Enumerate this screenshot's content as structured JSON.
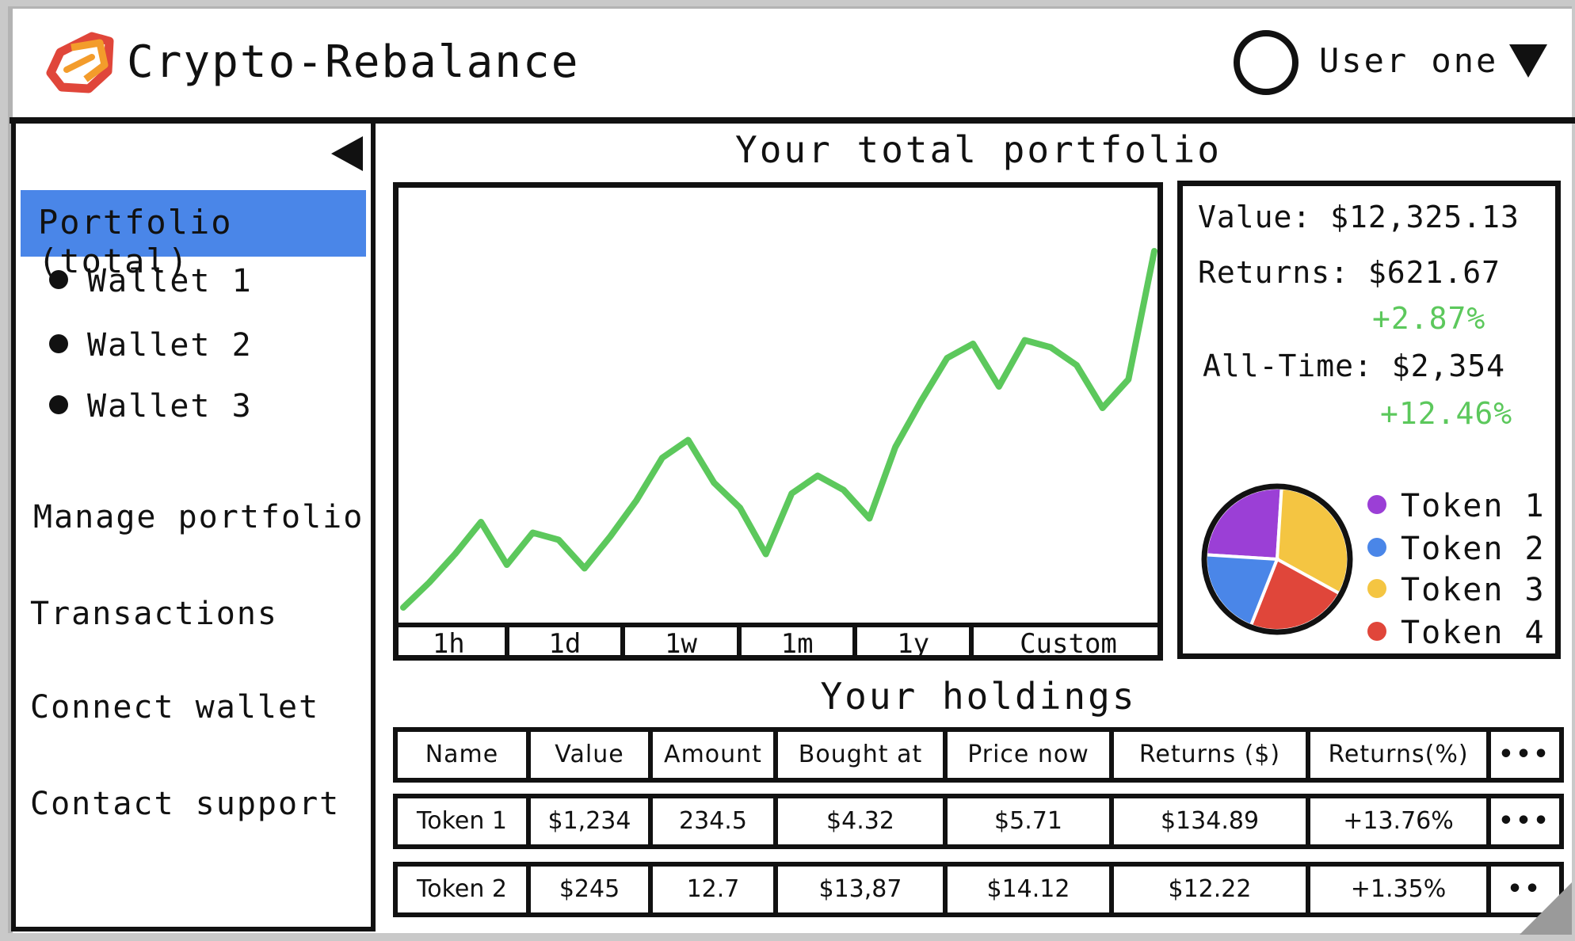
{
  "header": {
    "app_title": "Crypto-Rebalance",
    "user_name": "User one"
  },
  "sidebar": {
    "active_item": "Portfolio (total)",
    "wallets": [
      "Wallet 1",
      "Wallet 2",
      "Wallet 3"
    ],
    "nav_items": [
      "Manage portfolio",
      "Transactions",
      "Connect wallet",
      "Contact support"
    ]
  },
  "portfolio": {
    "title": "Your total portfolio",
    "time_ranges": [
      "1h",
      "1d",
      "1w",
      "1m",
      "1y",
      "Custom"
    ],
    "value": "Value: $12,325.13",
    "returns": "Returns: $621.67",
    "returns_pct": "+2.87%",
    "all_time": "All-Time: $2,354",
    "all_time_pct": "+12.46%",
    "tokens": [
      {
        "name": "Token 1",
        "color": "#9b3fd6",
        "share": 0.25
      },
      {
        "name": "Token 2",
        "color": "#4a86e8",
        "share": 0.2
      },
      {
        "name": "Token 3",
        "color": "#f4c542",
        "share": 0.32
      },
      {
        "name": "Token 4",
        "color": "#e0463a",
        "share": 0.23
      }
    ]
  },
  "holdings": {
    "title": "Your holdings",
    "columns": [
      "Name",
      "Value",
      "Amount",
      "Bought at",
      "Price now",
      "Returns ($)",
      "Returns(%)",
      "•••"
    ],
    "rows": [
      [
        "Token 1",
        "$1,234",
        "234.5",
        "$4.32",
        "$5.71",
        "$134.89",
        "+13.76%",
        "•••"
      ],
      [
        "Token 2",
        "$245",
        "12.7",
        "$13,87",
        "$14.12",
        "$12.22",
        "+1.35%",
        "••"
      ]
    ]
  },
  "colors": {
    "accent": "#4a86e8",
    "chart_line": "#5cc85c",
    "positive": "#5cc85c"
  },
  "chart_data": [
    {
      "type": "line",
      "series": [
        {
          "values": [
            0,
            7,
            15,
            24,
            12,
            21,
            19,
            11,
            20,
            30,
            42,
            47,
            35,
            28,
            15,
            32,
            37,
            33,
            25,
            45,
            58,
            70,
            74,
            62,
            75,
            73,
            68,
            56,
            64,
            100
          ]
        }
      ],
      "grid": false
    },
    {
      "type": "pie",
      "categories": [
        "Token 1",
        "Token 2",
        "Token 3",
        "Token 4"
      ],
      "values": [
        25,
        20,
        32,
        23
      ]
    }
  ]
}
